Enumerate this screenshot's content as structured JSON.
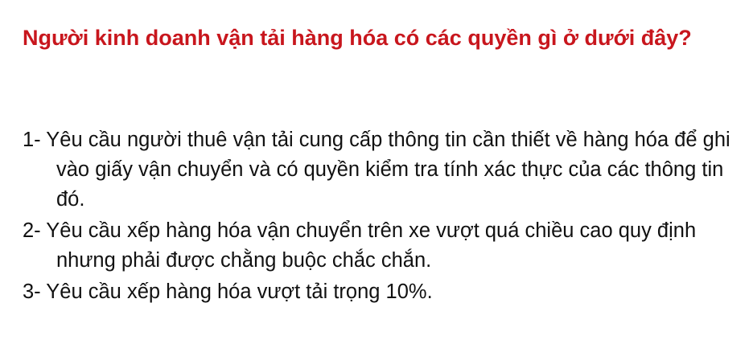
{
  "question": "Người kinh doanh vận tải hàng hóa có các quyền gì ở dưới đây?",
  "answers": [
    {
      "text": "1- Yêu cầu người thuê vận tải cung cấp thông tin cần thiết về hàng hóa để ghi vào giấy vận chuyển và có quyền kiểm tra tính xác thực của các thông tin đó."
    },
    {
      "text": "2- Yêu cầu xếp hàng hóa vận chuyển trên xe vượt quá chiều cao quy định nhưng phải được chằng buộc chắc chắn."
    },
    {
      "text": "3- Yêu cầu xếp hàng hóa vượt tải trọng 10%."
    }
  ],
  "colors": {
    "question": "#c8161d",
    "answer": "#111111",
    "background": "#ffffff"
  }
}
